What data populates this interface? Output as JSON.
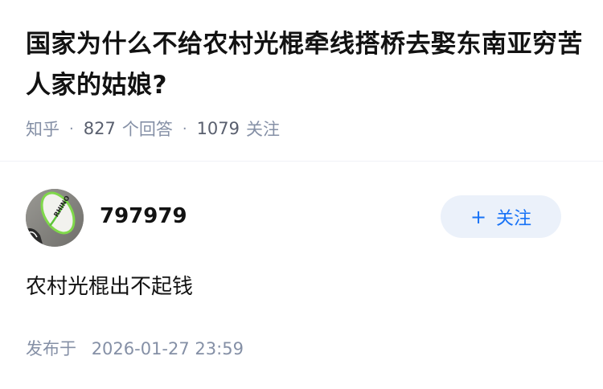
{
  "question": {
    "title": "国家为什么不给农村光棍牵线搭桥去娶东南亚穷苦人家的姑娘?"
  },
  "meta": {
    "source": "知乎",
    "separator": "·",
    "answer_count": "827",
    "answer_label": "个回答",
    "follower_count": "1079",
    "follower_label": "关注"
  },
  "author": {
    "name": "797979",
    "avatar_icon": "avatar-photo"
  },
  "follow_button": {
    "plus": "+",
    "label": "关注"
  },
  "answer": {
    "text": "农村光棍出不起钱"
  },
  "publish": {
    "label": "发布于",
    "datetime": "2026-01-27 23:59"
  },
  "colors": {
    "title": "#121212",
    "meta": "#8590a6",
    "accent": "#1772f6",
    "button_bg": "#ebf1fa"
  }
}
